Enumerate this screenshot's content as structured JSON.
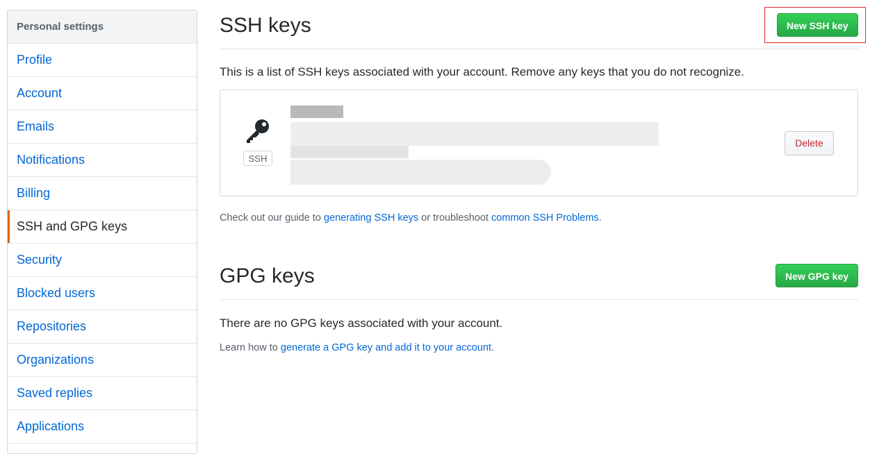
{
  "sidebar": {
    "header": "Personal settings",
    "items": [
      {
        "label": "Profile"
      },
      {
        "label": "Account"
      },
      {
        "label": "Emails"
      },
      {
        "label": "Notifications"
      },
      {
        "label": "Billing"
      },
      {
        "label": "SSH and GPG keys",
        "selected": true
      },
      {
        "label": "Security"
      },
      {
        "label": "Blocked users"
      },
      {
        "label": "Repositories"
      },
      {
        "label": "Organizations"
      },
      {
        "label": "Saved replies"
      },
      {
        "label": "Applications"
      }
    ]
  },
  "ssh": {
    "title": "SSH keys",
    "new_button": "New SSH key",
    "description": "This is a list of SSH keys associated with your account. Remove any keys that you do not recognize.",
    "key": {
      "icon": "key-icon",
      "type_label": "SSH",
      "delete_label": "Delete"
    },
    "guide_prefix": "Check out our guide to ",
    "guide_link1": "generating SSH keys",
    "guide_middle": " or troubleshoot ",
    "guide_link2": "common SSH Problems",
    "guide_suffix": "."
  },
  "gpg": {
    "title": "GPG keys",
    "new_button": "New GPG key",
    "empty_text": "There are no GPG keys associated with your account.",
    "learn_prefix": "Learn how to ",
    "learn_link": "generate a GPG key and add it to your account",
    "learn_suffix": "."
  },
  "colors": {
    "accent_link": "#0366d6",
    "primary_button": "#28a745",
    "selected_marker": "#e36209",
    "danger_text": "#cb2431"
  }
}
